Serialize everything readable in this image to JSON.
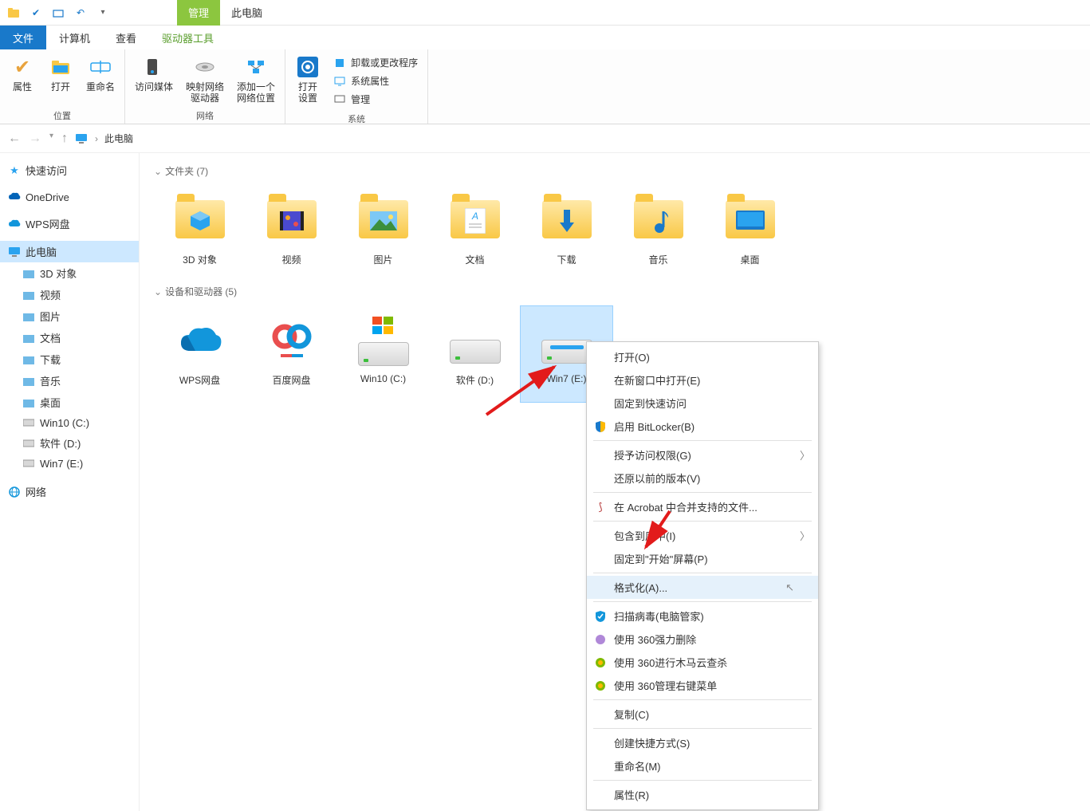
{
  "title_tabs": {
    "manage": "管理",
    "this_pc": "此电脑"
  },
  "ribbon_tabs": {
    "file": "文件",
    "computer": "计算机",
    "view": "查看",
    "drive_tools": "驱动器工具"
  },
  "ribbon": {
    "location": {
      "properties": "属性",
      "open": "打开",
      "rename": "重命名",
      "group": "位置"
    },
    "network": {
      "media": "访问媒体",
      "map_drive": "映射网络\n驱动器",
      "add_loc": "添加一个\n网络位置",
      "group": "网络"
    },
    "system": {
      "open_settings": "打开\n设置",
      "uninstall": "卸载或更改程序",
      "sys_props": "系统属性",
      "manage": "管理",
      "group": "系统"
    }
  },
  "breadcrumb": {
    "location": "此电脑"
  },
  "sidebar": {
    "quick": "快速访问",
    "onedrive": "OneDrive",
    "wps": "WPS网盘",
    "this_pc": "此电脑",
    "children": [
      {
        "label": "3D 对象"
      },
      {
        "label": "视频"
      },
      {
        "label": "图片"
      },
      {
        "label": "文档"
      },
      {
        "label": "下载"
      },
      {
        "label": "音乐"
      },
      {
        "label": "桌面"
      },
      {
        "label": "Win10 (C:)"
      },
      {
        "label": "软件 (D:)"
      },
      {
        "label": "Win7 (E:)"
      }
    ],
    "network": "网络"
  },
  "sections": {
    "folders": "文件夹 (7)",
    "devices": "设备和驱动器 (5)"
  },
  "folders": [
    {
      "label": "3D 对象"
    },
    {
      "label": "视频"
    },
    {
      "label": "图片"
    },
    {
      "label": "文档"
    },
    {
      "label": "下载"
    },
    {
      "label": "音乐"
    },
    {
      "label": "桌面"
    }
  ],
  "devices": [
    {
      "label": "WPS网盘"
    },
    {
      "label": "百度网盘"
    },
    {
      "label": "Win10 (C:)"
    },
    {
      "label": "软件 (D:)"
    },
    {
      "label": "Win7 (E:)"
    }
  ],
  "ctx": {
    "open": "打开(O)",
    "open_new": "在新窗口中打开(E)",
    "pin_quick": "固定到快速访问",
    "bitlocker": "启用 BitLocker(B)",
    "grant": "授予访问权限(G)",
    "restore": "还原以前的版本(V)",
    "acrobat": "在 Acrobat 中合并支持的文件...",
    "library": "包含到库中(I)",
    "pin_start": "固定到\"开始\"屏幕(P)",
    "format": "格式化(A)...",
    "scan": "扫描病毒(电脑管家)",
    "del360": "使用 360强力删除",
    "trojan360": "使用 360进行木马云查杀",
    "menu360": "使用 360管理右键菜单",
    "copy": "复制(C)",
    "shortcut": "创建快捷方式(S)",
    "rename": "重命名(M)",
    "props": "属性(R)"
  }
}
